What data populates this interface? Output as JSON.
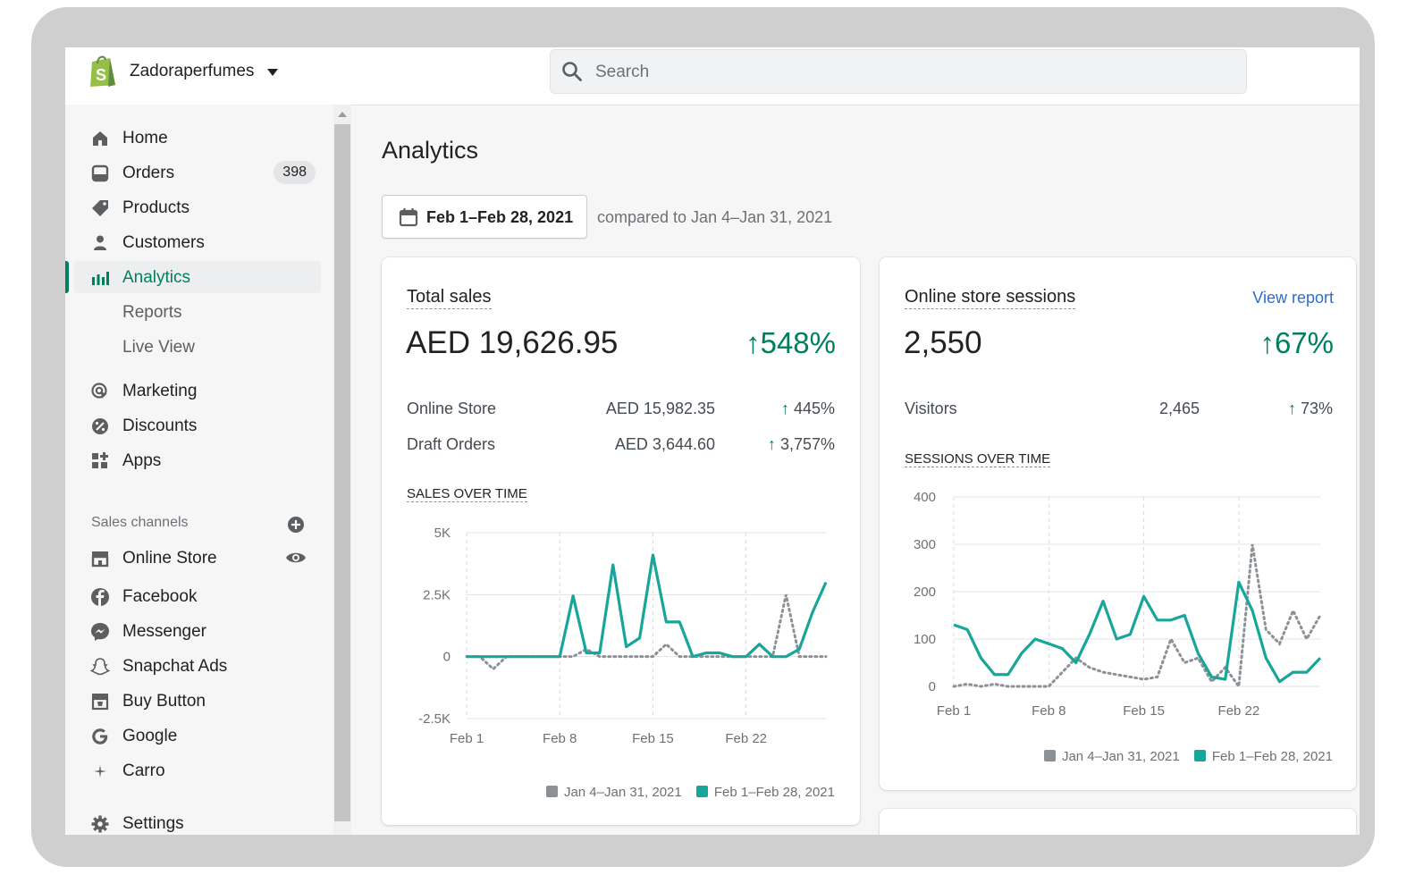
{
  "topbar": {
    "store_name": "Zadoraperfumes",
    "search_placeholder": "Search"
  },
  "sidebar": {
    "items": [
      {
        "label": "Home",
        "icon": "home-icon"
      },
      {
        "label": "Orders",
        "icon": "orders-icon",
        "badge": "398"
      },
      {
        "label": "Products",
        "icon": "tag-icon"
      },
      {
        "label": "Customers",
        "icon": "person-icon"
      },
      {
        "label": "Analytics",
        "icon": "bar-chart-icon",
        "active": true
      },
      {
        "label": "Reports"
      },
      {
        "label": "Live View"
      },
      {
        "label": "Marketing",
        "icon": "target-icon"
      },
      {
        "label": "Discounts",
        "icon": "discount-icon"
      },
      {
        "label": "Apps",
        "icon": "apps-icon"
      }
    ],
    "sales_channels_header": "Sales channels",
    "channels": [
      {
        "label": "Online Store",
        "icon": "store-icon"
      },
      {
        "label": "Facebook",
        "icon": "facebook-icon"
      },
      {
        "label": "Messenger",
        "icon": "messenger-icon"
      },
      {
        "label": "Snapchat Ads",
        "icon": "snapchat-icon"
      },
      {
        "label": "Buy Button",
        "icon": "buy-button-icon"
      },
      {
        "label": "Google",
        "icon": "google-icon"
      },
      {
        "label": "Carro",
        "icon": "sparkle-icon"
      }
    ],
    "settings": "Settings"
  },
  "main": {
    "title": "Analytics",
    "date_range": "Feb 1–Feb 28, 2021",
    "compare_text": "compared to Jan 4–Jan 31, 2021"
  },
  "colors": {
    "accent": "#008060",
    "current_series": "#18a59a",
    "previous_series": "#8c9196",
    "link": "#2c6ecb"
  },
  "sales_card": {
    "title": "Total sales",
    "value": "AED 19,626.95",
    "change": "548%",
    "rows": [
      {
        "label": "Online Store",
        "value": "AED 15,982.35",
        "change": "445%"
      },
      {
        "label": "Draft Orders",
        "value": "AED 3,644.60",
        "change": "3,757%"
      }
    ],
    "chart_title": "SALES OVER TIME",
    "legend": [
      "Jan 4–Jan 31, 2021",
      "Feb 1–Feb 28, 2021"
    ]
  },
  "sessions_card": {
    "title": "Online store sessions",
    "view_report": "View report",
    "value": "2,550",
    "change": "67%",
    "rows": [
      {
        "label": "Visitors",
        "value": "2,465",
        "change": "73%"
      }
    ],
    "chart_title": "SESSIONS OVER TIME",
    "legend": [
      "Jan 4–Jan 31, 2021",
      "Feb 1–Feb 28, 2021"
    ]
  },
  "chart_data": [
    {
      "type": "line",
      "title": "SALES OVER TIME",
      "x": [
        1,
        2,
        3,
        4,
        5,
        6,
        7,
        8,
        9,
        10,
        11,
        12,
        13,
        14,
        15,
        16,
        17,
        18,
        19,
        20,
        21,
        22,
        23,
        24,
        25,
        26,
        27,
        28
      ],
      "x_ticks": [
        "Feb 1",
        "Feb 8",
        "Feb 15",
        "Feb 22"
      ],
      "x_tick_positions": [
        1,
        8,
        15,
        22
      ],
      "y_ticks": [
        "5K",
        "2.5K",
        "0",
        "-2.5K"
      ],
      "y_tick_values": [
        5000,
        2500,
        0,
        -2500
      ],
      "ylim": [
        -2500,
        5000
      ],
      "xlim": [
        1,
        28
      ],
      "grid": true,
      "series": [
        {
          "name": "Jan 4–Jan 31, 2021",
          "style": "dotted",
          "values": [
            0,
            0,
            -500,
            0,
            0,
            0,
            0,
            0,
            0,
            300,
            0,
            0,
            0,
            0,
            0,
            500,
            0,
            0,
            0,
            0,
            0,
            0,
            0,
            0,
            2500,
            0,
            0,
            0
          ]
        },
        {
          "name": "Feb 1–Feb 28, 2021",
          "style": "solid",
          "values": [
            0,
            0,
            0,
            0,
            0,
            0,
            0,
            0,
            2450,
            150,
            150,
            3700,
            400,
            750,
            4100,
            1400,
            1400,
            0,
            150,
            150,
            0,
            0,
            500,
            0,
            0,
            300,
            1800,
            3000
          ]
        }
      ]
    },
    {
      "type": "line",
      "title": "SESSIONS OVER TIME",
      "x": [
        1,
        2,
        3,
        4,
        5,
        6,
        7,
        8,
        9,
        10,
        11,
        12,
        13,
        14,
        15,
        16,
        17,
        18,
        19,
        20,
        21,
        22,
        23,
        24,
        25,
        26,
        27,
        28
      ],
      "x_ticks": [
        "Feb 1",
        "Feb 8",
        "Feb 15",
        "Feb 22"
      ],
      "x_tick_positions": [
        1,
        8,
        15,
        22
      ],
      "y_ticks": [
        "400",
        "300",
        "200",
        "100",
        "0"
      ],
      "y_tick_values": [
        400,
        300,
        200,
        100,
        0
      ],
      "ylim": [
        0,
        400
      ],
      "xlim": [
        1,
        28
      ],
      "grid": true,
      "series": [
        {
          "name": "Jan 4–Jan 31, 2021",
          "style": "dotted",
          "values": [
            0,
            5,
            0,
            5,
            0,
            0,
            0,
            0,
            30,
            60,
            40,
            30,
            25,
            20,
            15,
            20,
            100,
            50,
            60,
            10,
            40,
            0,
            300,
            120,
            90,
            160,
            100,
            150
          ]
        },
        {
          "name": "Feb 1–Feb 28, 2021",
          "style": "solid",
          "values": [
            130,
            120,
            60,
            25,
            25,
            70,
            100,
            90,
            80,
            50,
            110,
            180,
            100,
            110,
            190,
            140,
            140,
            150,
            70,
            20,
            15,
            220,
            160,
            60,
            10,
            30,
            30,
            60
          ]
        }
      ]
    }
  ]
}
